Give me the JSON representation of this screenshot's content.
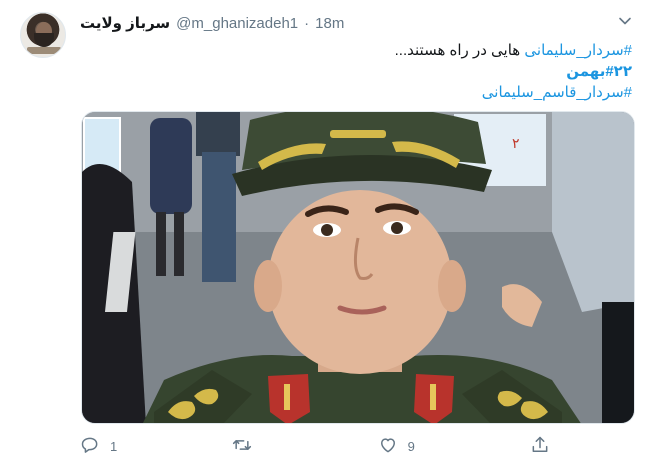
{
  "tweet": {
    "display_name": "سرباز ولایت",
    "handle": "@m_ghanizadeh1",
    "separator": "·",
    "time": "18m",
    "body": {
      "line1_hashtag": "#سردار_سلیمانی",
      "line1_text": " هایی در راه هستند...",
      "line2_hashtag": "#۲۲بهمن",
      "line3_hashtag": "#سردار_قاسم_سلیمانی"
    },
    "actions": {
      "reply_count": "1",
      "retweet_count": "",
      "like_count": "9"
    }
  },
  "icons": {
    "caret": "chevron-down-icon",
    "reply": "reply-icon",
    "retweet": "retweet-icon",
    "like": "heart-icon",
    "share": "share-icon"
  },
  "colors": {
    "link": "#1b95e0",
    "secondary_text": "#657786",
    "primary_text": "#14171a",
    "border": "#e1e8ed"
  }
}
